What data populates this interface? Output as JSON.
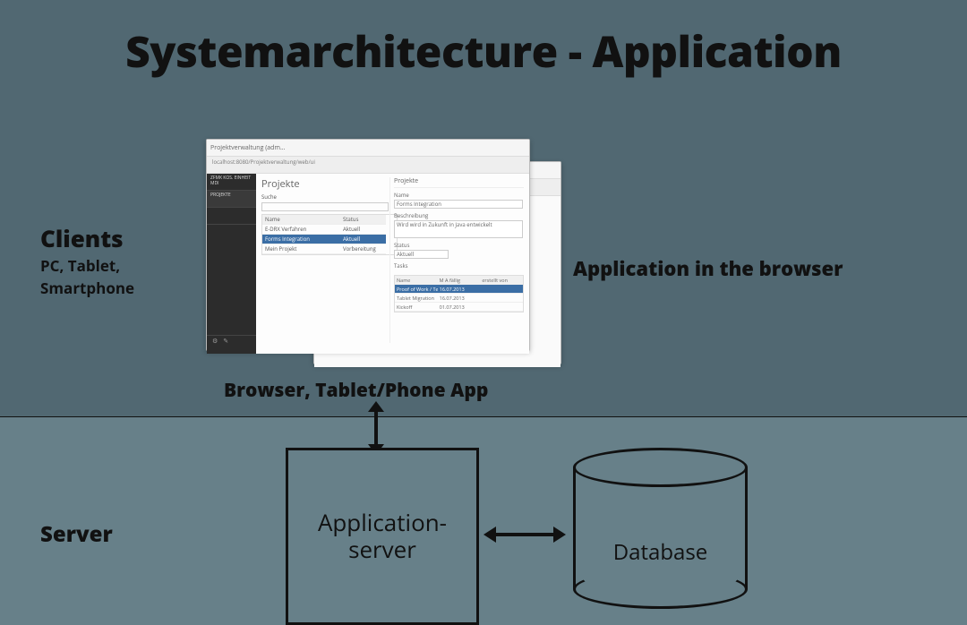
{
  "title": "Systemarchitecture - Application",
  "clients": {
    "heading": "Clients",
    "sub1": "PC, Tablet,",
    "sub2": "Smartphone"
  },
  "app_in_browser": "Application in the browser",
  "browser_caption": "Browser, Tablet/Phone App",
  "server_label": "Server",
  "appserver": {
    "line1": "Application-",
    "line2": "server"
  },
  "database": "Database",
  "window": {
    "tab": "Projektverwaltung (adm...",
    "addr": "localhost:8080/Projektverwaltung/web/ui",
    "page_title": "Projekte",
    "search_label": "Suche",
    "cols": {
      "name": "Name",
      "status": "Status"
    },
    "rows": [
      {
        "name": "E-DRX Verfahren",
        "status": "Aktuell"
      },
      {
        "name": "Forms Integration",
        "status": "Aktuell"
      },
      {
        "name": "Mein Projekt",
        "status": "Vorbereitung"
      }
    ],
    "detail": {
      "panel_title": "Projekte",
      "name_label": "Name",
      "name_value": "Forms Integration",
      "desc_label": "Beschreibung",
      "desc_value": "Wird wird in Zukunft in Java entwickelt",
      "status_label": "Status",
      "status_value": "Aktuell",
      "tasks_label": "Tasks",
      "task_cols": {
        "name": "Name",
        "due": "M A fällig",
        "done": "erstellt von"
      },
      "tasks": [
        {
          "name": "Proof of Work / Test",
          "due": "16.07.2013",
          "done": ""
        },
        {
          "name": "Tablet Migration",
          "due": "16.07.2013",
          "done": ""
        },
        {
          "name": "Kickoff",
          "due": "01.07.2013",
          "done": ""
        }
      ]
    }
  }
}
